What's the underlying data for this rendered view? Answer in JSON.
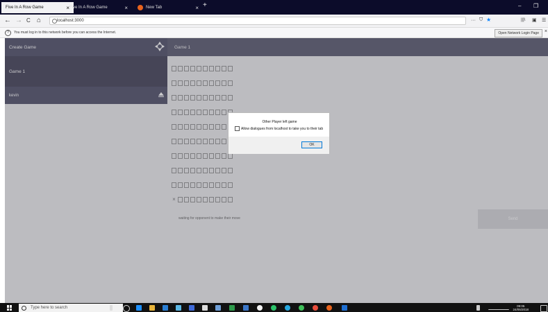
{
  "browser": {
    "tabs": [
      {
        "label": "Five In A Row Game",
        "close": "×"
      },
      {
        "label": "Five In A Row Game",
        "close": "×"
      },
      {
        "label": "New Tab",
        "close": "×"
      }
    ],
    "new_tab": "+",
    "window_controls": {
      "minimize": "–",
      "restore": "❐"
    },
    "nav": {
      "back": "←",
      "forward": "→",
      "reload": "C",
      "home": "⌂"
    },
    "url": "localhost:3000",
    "toolbar_right": {
      "more": "···",
      "pocket": "⛉",
      "star": "★",
      "library": "|||\\",
      "sidebar": "▣",
      "menu": "☰"
    },
    "info_bar": {
      "icon": "?",
      "message": "You must log in to this network before you can access the Internet.",
      "button": "Open Network Login Page",
      "close": "×"
    }
  },
  "app": {
    "sidebar": {
      "create_game": "Create Game",
      "game_item": "Game 1",
      "username": "kevin"
    },
    "main": {
      "header": "Game 1",
      "board_rows": 10,
      "board_cols": 10,
      "last_row_marker": "×",
      "waiting_text": "waiting for opponent to make their move",
      "send_button": "Send"
    }
  },
  "dialog": {
    "message": "Other Player left game",
    "checkbox_label": "Allow dialogues from localhost to take you to their tab",
    "ok_button": "OK"
  },
  "taskbar": {
    "search_placeholder": "Type here to search",
    "clock_time": "09:05",
    "clock_date": "24/05/2018",
    "accent": "#111111"
  }
}
